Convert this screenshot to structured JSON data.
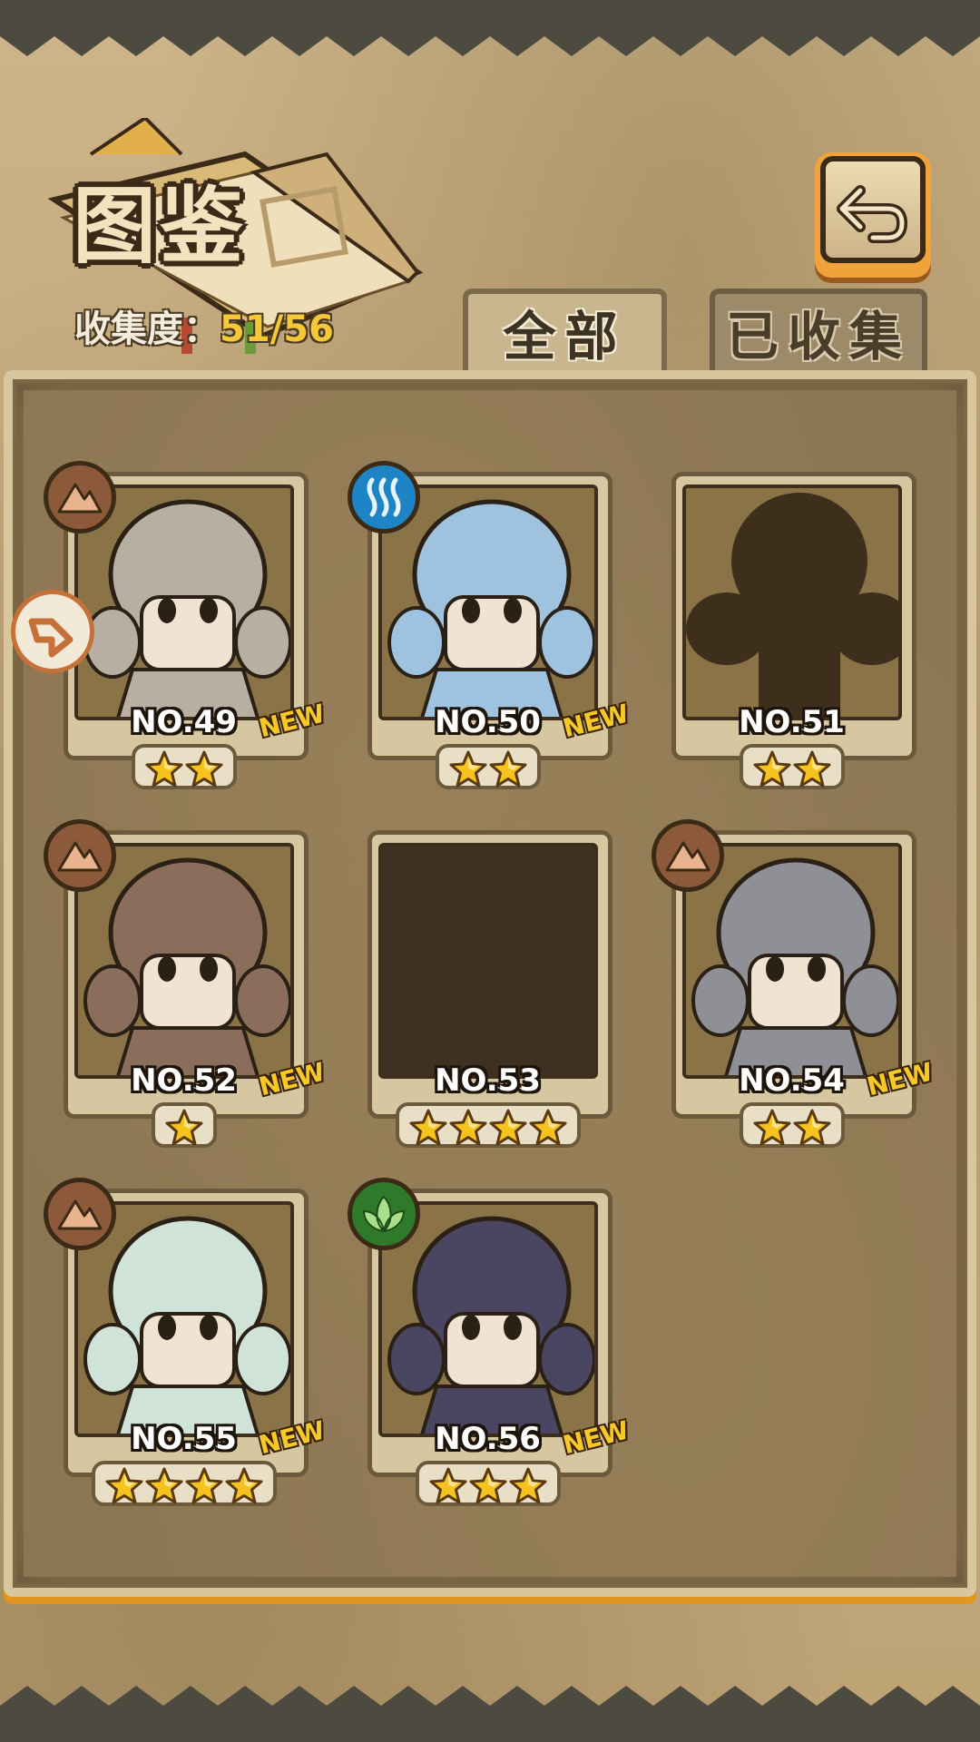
{
  "header": {
    "title": "图鉴",
    "collection_label": "收集度：",
    "collection_value": "51/56"
  },
  "tabs": [
    {
      "label": "全部",
      "active": true
    },
    {
      "label": "已收集",
      "active": false
    }
  ],
  "cards": [
    {
      "number": "NO.49",
      "stars": 2,
      "new": "NEW",
      "element": "earth-icon",
      "state": "unlocked"
    },
    {
      "number": "NO.50",
      "stars": 2,
      "new": "NEW",
      "element": "water-icon",
      "state": "unlocked"
    },
    {
      "number": "NO.51",
      "stars": 2,
      "new": "",
      "element": "",
      "state": "silhouette"
    },
    {
      "number": "NO.52",
      "stars": 1,
      "new": "NEW",
      "element": "earth-icon",
      "state": "unlocked"
    },
    {
      "number": "NO.53",
      "stars": 4,
      "new": "",
      "element": "",
      "state": "empty"
    },
    {
      "number": "NO.54",
      "stars": 2,
      "new": "NEW",
      "element": "earth-icon",
      "state": "unlocked"
    },
    {
      "number": "NO.55",
      "stars": 4,
      "new": "NEW",
      "element": "earth-icon",
      "state": "unlocked"
    },
    {
      "number": "NO.56",
      "stars": 3,
      "new": "NEW",
      "element": "nature-icon",
      "state": "unlocked"
    }
  ],
  "colors": {
    "accent_gold": "#f5c838",
    "panel_brown": "#8d7753",
    "frame_cream": "#d7c7a0",
    "orange_trim": "#e2961f"
  }
}
